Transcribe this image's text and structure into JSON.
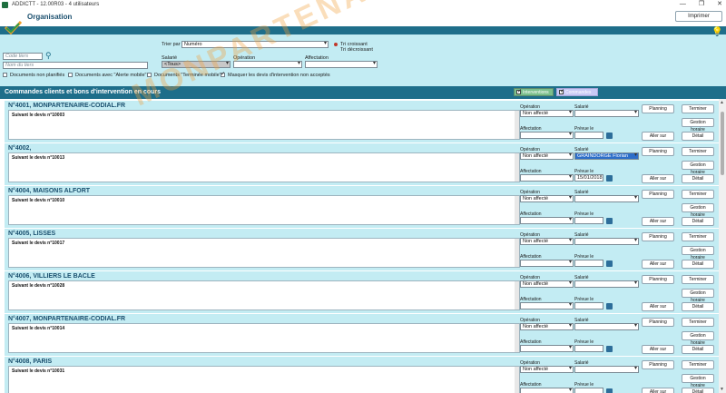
{
  "window": {
    "title": "ADDICTT - 12.00R03 - 4 utilisateurs"
  },
  "header": {
    "title": "Organisation",
    "print_label": "Imprimer"
  },
  "filters": {
    "code_tiers_placeholder": "Code tiers",
    "nom_tiers_placeholder": "Nom du tiers",
    "trier_par_label": "Trier par",
    "trier_par_value": "Numéro",
    "tri_croissant": "Tri croissant",
    "tri_decroissant": "Tri décroissant",
    "salarie_label": "Salarié",
    "salarie_value": "<Tous>",
    "operation_label": "Opération",
    "affectation_label": "Affectation",
    "chk_non_planifiee": "Documents non planifiés",
    "chk_alerte_mobile": "Documents avec \"Alerte mobile\"",
    "chk_terminee_mobile": "Documents \"Terminée mobile\"",
    "chk_masquer": "Masquer les devis d'intervention non acceptés"
  },
  "section": {
    "title": "Commandes clients et bons d'intervention en cours",
    "toggle_interventions": "Interventions",
    "toggle_commandes": "Commandes"
  },
  "card_labels": {
    "operation": "Opération",
    "salarie": "Salarié",
    "affectation": "Affectation",
    "prevue_le": "Prévue le",
    "planning": "Planning",
    "terminer": "Terminer",
    "gestion_horaire": "Gestion horaire",
    "aller_sur": "Aller sur",
    "detail": "Détail"
  },
  "orders": [
    {
      "head": "N°4001, MONPARTENAIRE-CODIAL.FR",
      "desc": "Suivant le devis n°10003",
      "operation": "Non affecté",
      "salarie": "",
      "date": ""
    },
    {
      "head": "N°4002,",
      "desc": "Suivant le devis n°10013",
      "operation": "Non affecté",
      "salarie": "GRAINDORGE Florian",
      "date": "15/01/2018"
    },
    {
      "head": "N°4004, MAISONS ALFORT",
      "desc": "Suivant le devis n°10010",
      "operation": "Non affecté",
      "salarie": "",
      "date": ""
    },
    {
      "head": "N°4005, LISSES",
      "desc": "Suivant le devis n°10017",
      "operation": "Non affecté",
      "salarie": "",
      "date": ""
    },
    {
      "head": "N°4006, VILLIERS LE BACLE",
      "desc": "Suivant le devis n°10028",
      "operation": "Non affecté",
      "salarie": "",
      "date": ""
    },
    {
      "head": "N°4007, MONPARTENAIRE-CODIAL.FR",
      "desc": "Suivant le devis n°10014",
      "operation": "Non affecté",
      "salarie": "",
      "date": ""
    },
    {
      "head": "N°4008, PARIS",
      "desc": "Suivant le devis n°10031",
      "operation": "Non affecté",
      "salarie": "",
      "date": ""
    }
  ],
  "watermark": "MONPARTENAIRE-CODIAL.FR",
  "colors": {
    "band": "#1e6e8a",
    "panel": "#c3ecf3",
    "title": "#1a4f6e"
  }
}
